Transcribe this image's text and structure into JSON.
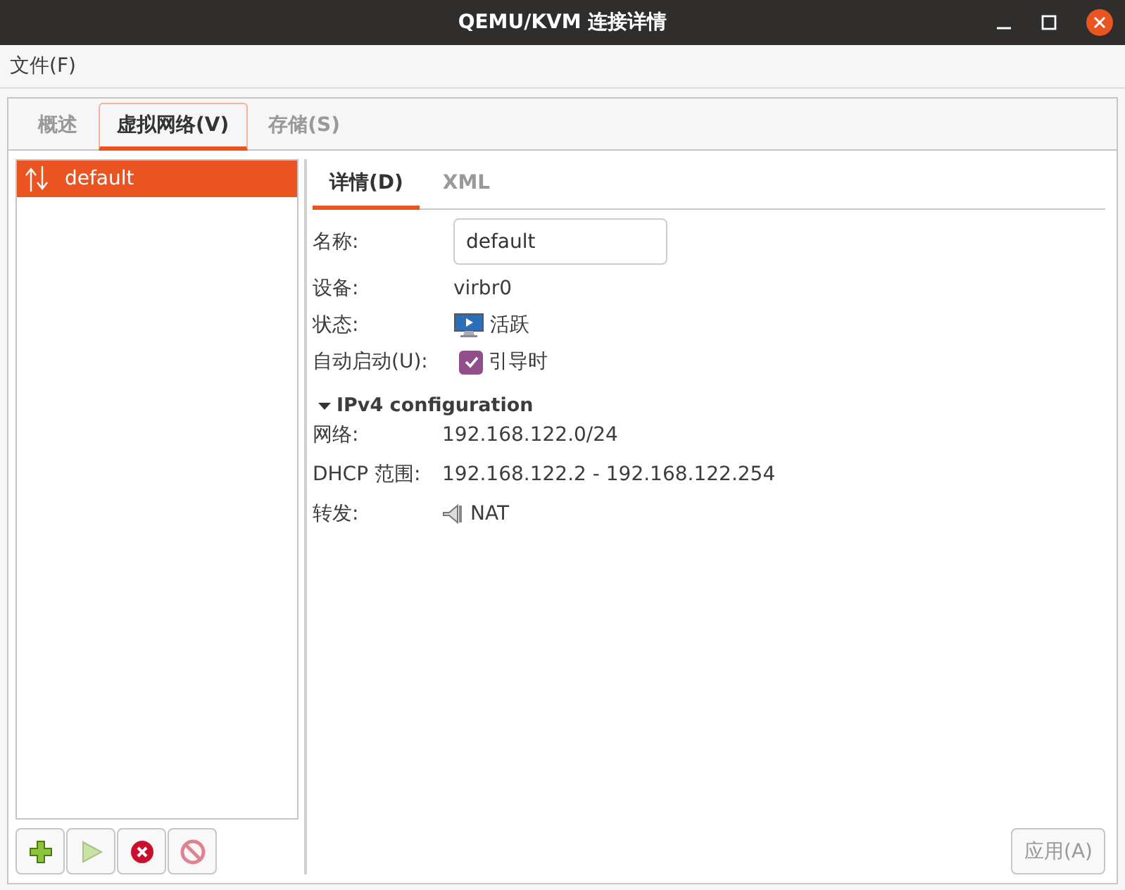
{
  "window": {
    "title": "QEMU/KVM 连接详情"
  },
  "menu": [
    {
      "label": "文件(F)"
    }
  ],
  "tabs": [
    {
      "label": "概述",
      "selected": false
    },
    {
      "label": "虚拟网络(V)",
      "selected": true
    },
    {
      "label": "存储(S)",
      "selected": false
    }
  ],
  "networks": [
    {
      "name": "default",
      "selected": true
    }
  ],
  "list_buttons": [
    {
      "kind": "add",
      "disabled": false
    },
    {
      "kind": "start",
      "disabled": true
    },
    {
      "kind": "delete",
      "disabled": false
    },
    {
      "kind": "stop",
      "disabled": true
    }
  ],
  "subtabs": [
    {
      "label": "详情(D)",
      "selected": true
    },
    {
      "label": "XML",
      "selected": false
    }
  ],
  "details": {
    "name_label": "名称:",
    "name_value": "default",
    "device_label": "设备:",
    "device_value": "virbr0",
    "state_label": "状态:",
    "state_value": "活跃",
    "autostart_label": "自动启动(U):",
    "autostart_text": "引导时",
    "autostart_checked": true
  },
  "ipv4": {
    "title": "IPv4 configuration",
    "expanded": true,
    "network_label": "网络:",
    "network_value": "192.168.122.0/24",
    "dhcp_label": "DHCP 范围:",
    "dhcp_value": "192.168.122.2 - 192.168.122.254",
    "forward_label": "转发:",
    "forward_value": "NAT"
  },
  "apply_button": {
    "label": "应用(A)",
    "disabled": true
  }
}
